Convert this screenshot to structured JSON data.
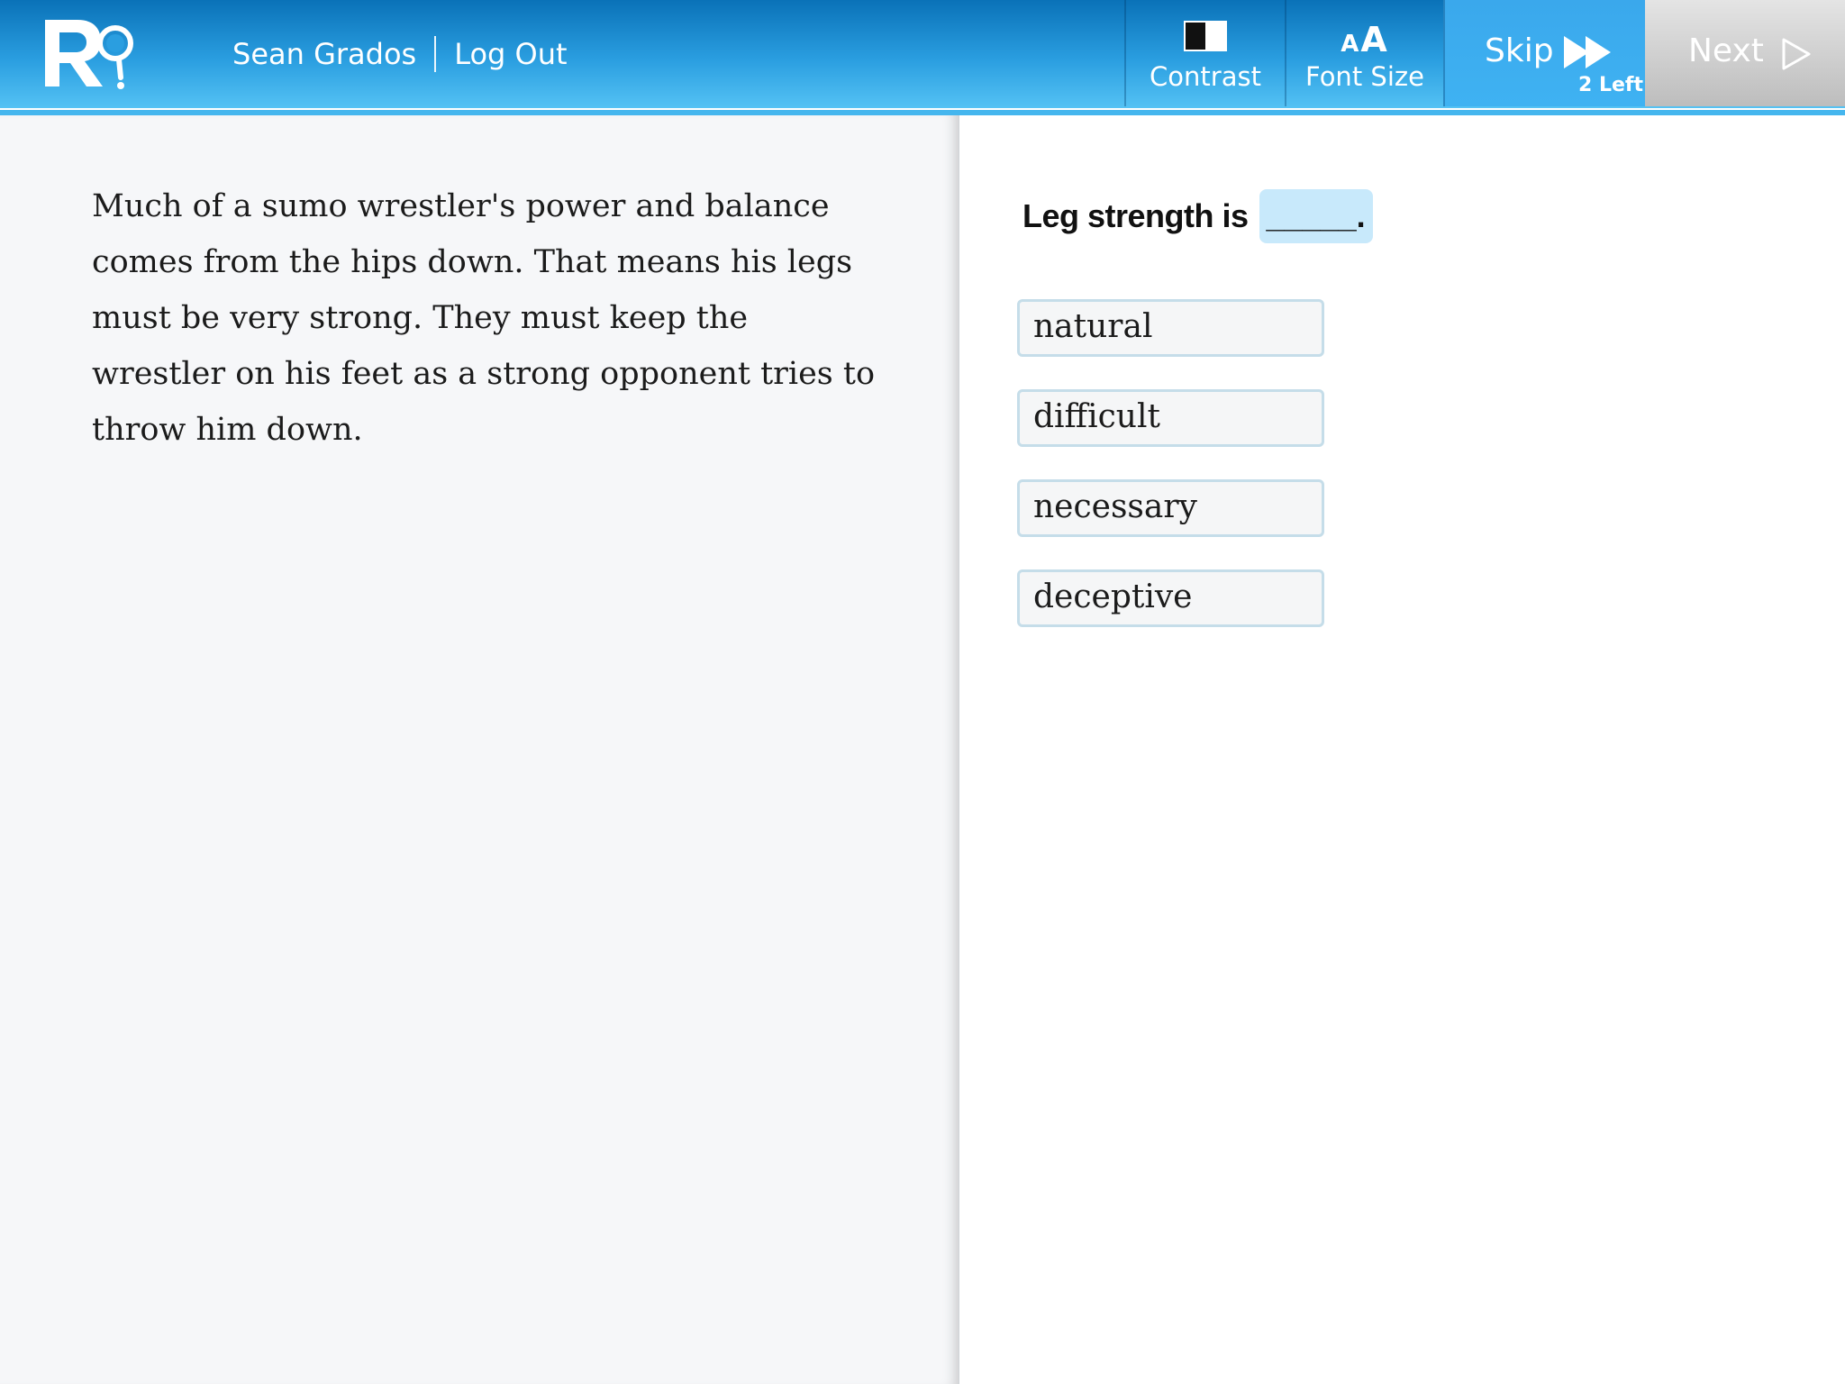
{
  "header": {
    "logo_icon": "reading-magnifier-logo",
    "user_name": "Sean Grados",
    "logout_label": "Log Out",
    "contrast_label": "Contrast",
    "contrast_icon": "contrast-icon",
    "font_size_label": "Font Size",
    "font_size_icon": "font-size-icon",
    "font_size_icon_small": "A",
    "font_size_icon_big": "A",
    "skip_label": "Skip",
    "skip_icon": "fast-forward-icon",
    "skip_remaining": "2 Left",
    "next_label": "Next",
    "next_icon": "play-arrow-icon"
  },
  "passage": {
    "text": "Much of a sumo wrestler's power and balance comes from the hips down. That means his legs must be very strong. They must keep the wrestler on his feet as a strong opponent tries to throw him down."
  },
  "question": {
    "prompt": "Leg strength is",
    "blank": "_____.",
    "choices": [
      "natural",
      "difficult",
      "necessary",
      "deceptive"
    ]
  },
  "colors": {
    "header_top": "#0a72b8",
    "header_bottom": "#54c2f4",
    "skip_bg": "#3fb2f2",
    "next_bg": "#c8c8c8",
    "blank_bg": "#c8e9fb",
    "choice_border": "#c5dde9",
    "passage_bg": "#f6f7f9"
  }
}
